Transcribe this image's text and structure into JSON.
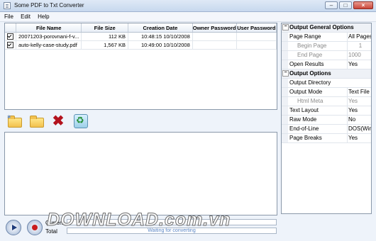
{
  "window": {
    "title": "Some PDF to Txt Converter"
  },
  "menu": [
    "File",
    "Edit",
    "Help"
  ],
  "files": {
    "headers": [
      "File Name",
      "File Size",
      "Creation Date",
      "Owner Password",
      "User Password"
    ],
    "rows": [
      {
        "checked": true,
        "name": "20071203-porovnani-f-v...",
        "size": "112 KB",
        "date": "10:48:15 10/10/2008",
        "owner": "",
        "user": ""
      },
      {
        "checked": true,
        "name": "auto-kelly-case-study.pdf",
        "size": "1,567 KB",
        "date": "10:49:00 10/10/2008",
        "owner": "",
        "user": ""
      }
    ]
  },
  "toolbar": {
    "icons": [
      "add-file-icon",
      "open-folder-icon",
      "remove-icon",
      "clear-icon"
    ]
  },
  "progress": {
    "current_label": "Current",
    "total_label": "Total",
    "status": "Waiting for converting",
    "current_fraction": 0,
    "total_fraction": 0
  },
  "watermark": "DOWNLOAD.com.vn",
  "properties": {
    "rows": [
      {
        "name": "Output General Options",
        "value": "",
        "kind": "cat"
      },
      {
        "name": "Page Range",
        "value": "All Pages",
        "kind": "item"
      },
      {
        "name": "Begin Page",
        "value": "1",
        "kind": "sub",
        "disabled": true
      },
      {
        "name": "End Page",
        "value": "1000",
        "kind": "sub",
        "disabled": true
      },
      {
        "name": "Open Results",
        "value": "Yes",
        "kind": "item"
      },
      {
        "name": "Output Options",
        "value": "",
        "kind": "cat"
      },
      {
        "name": "Output Directory",
        "value": "",
        "kind": "item"
      },
      {
        "name": "Output Mode",
        "value": "Text File",
        "kind": "item"
      },
      {
        "name": "Html Meta",
        "value": "Yes",
        "kind": "sub",
        "disabled": true
      },
      {
        "name": "Text Layout",
        "value": "Yes",
        "kind": "item"
      },
      {
        "name": "Raw Mode",
        "value": "No",
        "kind": "item"
      },
      {
        "name": "End-of-Line",
        "value": "DOS(Wind",
        "kind": "item"
      },
      {
        "name": "Page Breaks",
        "value": "Yes",
        "kind": "item"
      }
    ]
  }
}
